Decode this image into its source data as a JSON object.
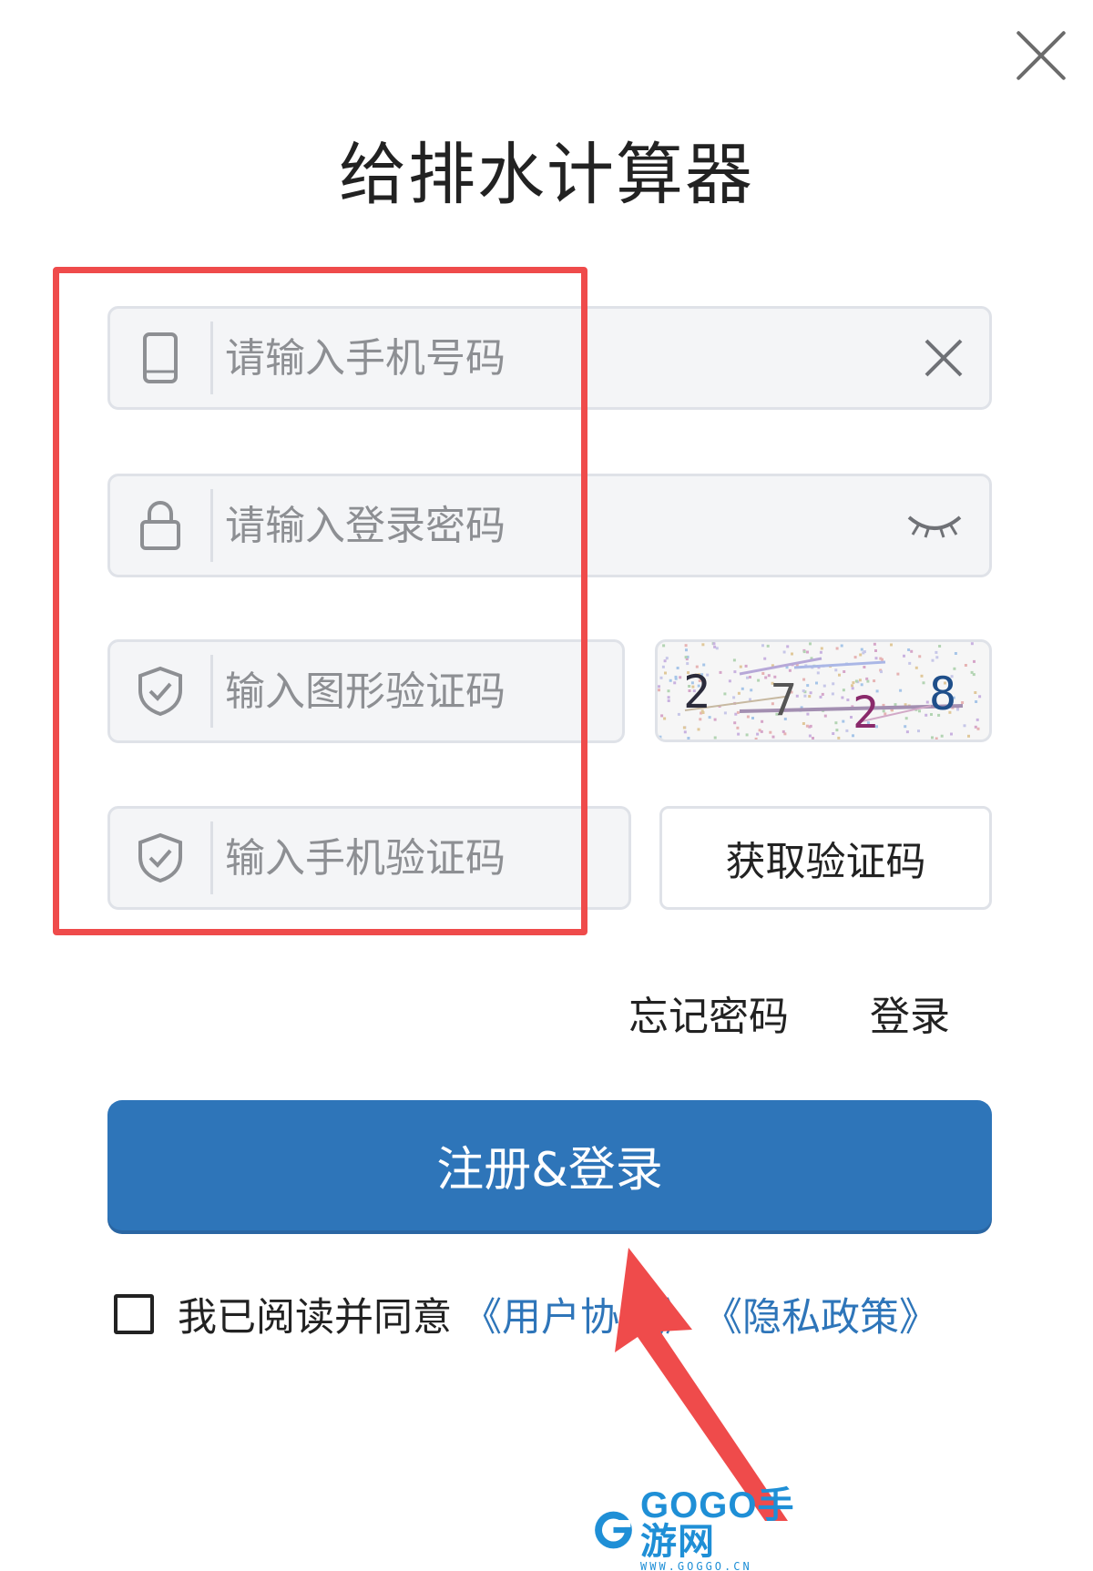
{
  "window": {
    "title": "给排水计算器"
  },
  "form": {
    "phone_placeholder": "请输入手机号码",
    "password_placeholder": "请输入登录密码",
    "captcha_placeholder": "输入图形验证码",
    "captcha_image_text": "2728",
    "sms_placeholder": "输入手机验证码",
    "get_code_label": "获取验证码",
    "forgot_password_label": "忘记密码",
    "login_label": "登录",
    "submit_label": "注册&登录"
  },
  "agreement": {
    "text": "我已阅读并同意",
    "user_agreement": "《用户协议》",
    "privacy_policy": "《隐私政策》",
    "checked": false
  },
  "icons": {
    "close": "close-icon",
    "phone": "mobile-phone-icon",
    "clear": "clear-icon",
    "lock": "lock-icon",
    "eye": "eye-closed-icon",
    "shield": "shield-check-icon"
  },
  "colors": {
    "primary": "#2e75b9",
    "annotation": "#ef4b4b",
    "field_bg": "#f4f5f7",
    "field_border": "#dfe2e8"
  },
  "watermark": {
    "text": "GOGO手游网",
    "url": "WWW.GOGGO.CN"
  }
}
